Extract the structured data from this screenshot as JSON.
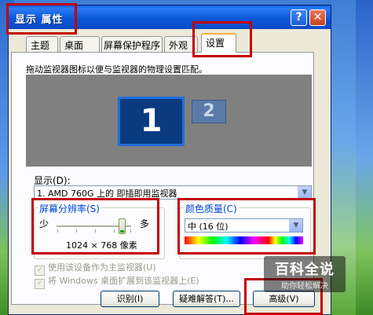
{
  "window": {
    "title": "显示 属性",
    "help_glyph": "?",
    "close_glyph": "✕"
  },
  "tabs": [
    {
      "label": "主题"
    },
    {
      "label": "桌面"
    },
    {
      "label": "屏幕保护程序"
    },
    {
      "label": "外观"
    },
    {
      "label": "设置",
      "active": true
    }
  ],
  "settings": {
    "description": "拖动监视器图标以便与监视器的物理设置匹配。",
    "monitors": [
      {
        "number": "1",
        "selected": true
      },
      {
        "number": "2",
        "selected": false
      }
    ],
    "display_label": "显示(D):",
    "display_value": "1. AMD 760G 上的 即插即用监视器",
    "resolution": {
      "legend": "屏幕分辨率(S)",
      "min_label": "少",
      "max_label": "多",
      "value_text": "1024 × 768 像素",
      "slider_fraction": 0.85
    },
    "color_quality": {
      "legend": "颜色质量(C)",
      "value": "中 (16 位)"
    },
    "checkboxes": [
      {
        "label": "使用该设备作为主监视器(U)",
        "checked": true
      },
      {
        "label": "将 Windows 桌面扩展到该监视器上(E)",
        "checked": true
      }
    ],
    "buttons": {
      "identify": "识别(I)",
      "troubleshoot": "疑难解答(T)...",
      "advanced": "高级(V)"
    }
  },
  "watermark": {
    "title": "百科全说",
    "subtitle": "助你轻松解决"
  },
  "colors": {
    "highlight_box": "#c40000",
    "titlebar": "#0a57d8",
    "dialog_bg": "#ece9d8"
  }
}
